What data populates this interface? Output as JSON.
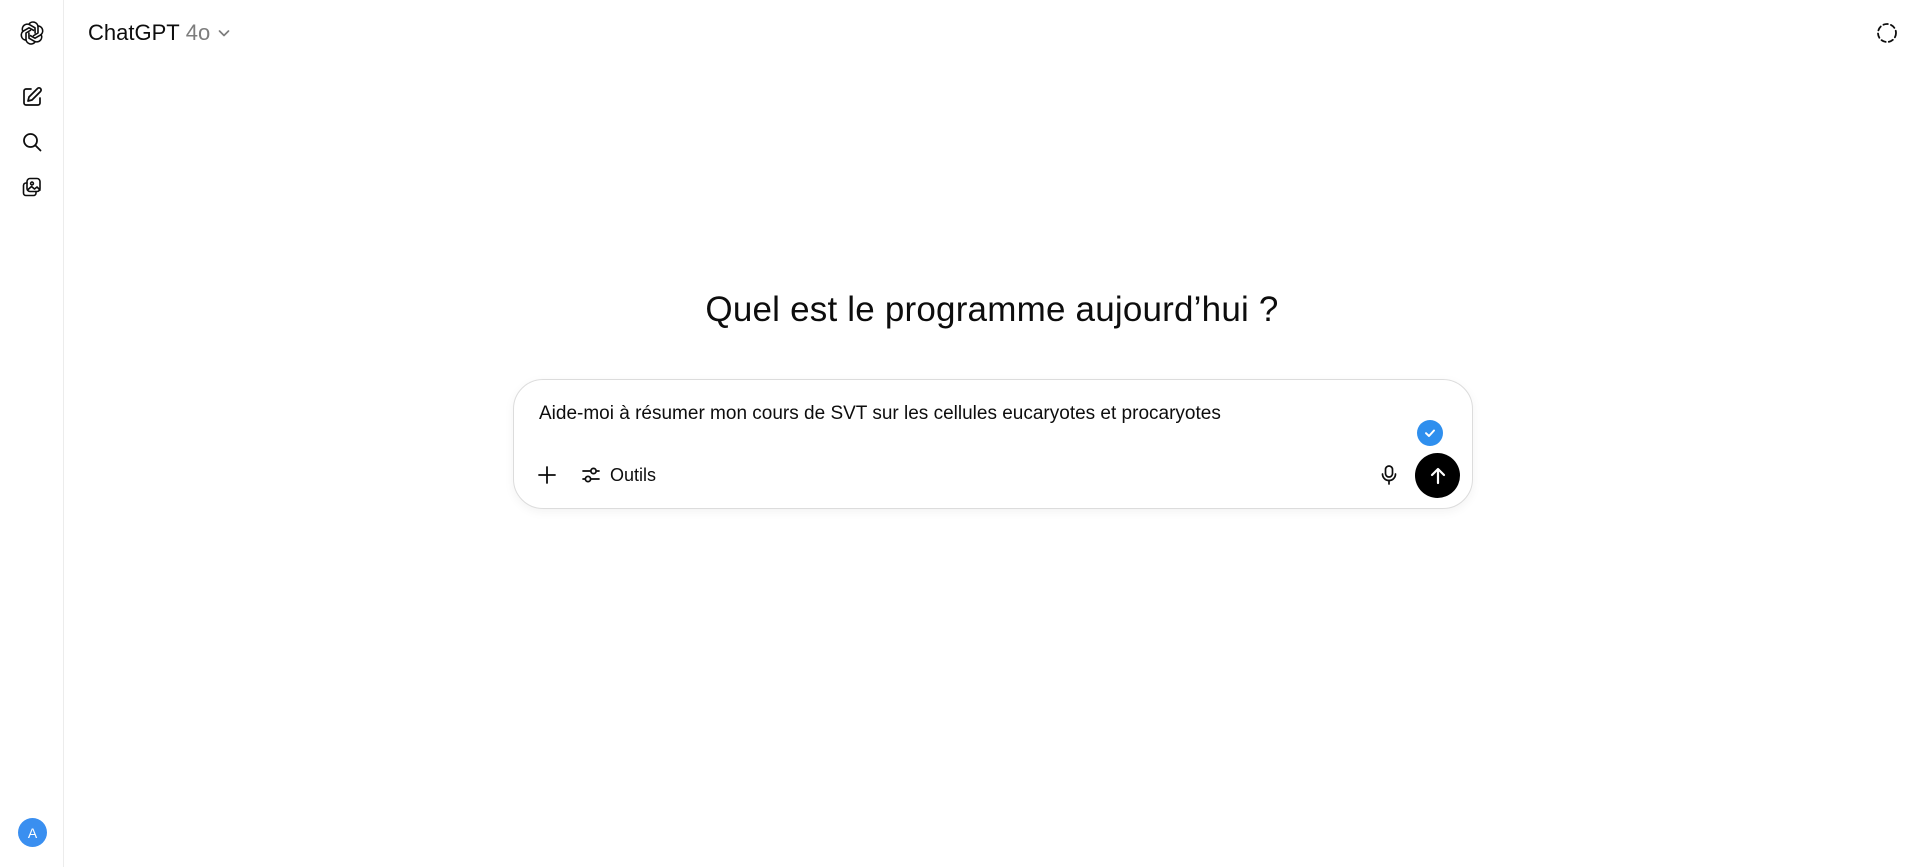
{
  "header": {
    "model_name": "ChatGPT",
    "model_version": "4o"
  },
  "sidebar": {
    "items": [
      {
        "name": "new-chat",
        "icon": "edit-icon"
      },
      {
        "name": "search",
        "icon": "search-icon"
      },
      {
        "name": "library",
        "icon": "images-icon"
      }
    ],
    "avatar_initial": "A",
    "avatar_color": "#3a8ff0"
  },
  "main": {
    "headline": "Quel est le programme aujourd’hui ?"
  },
  "composer": {
    "input_value": "Aide-moi à résumer mon cours de SVT sur les cellules eucaryotes et procaryotes",
    "tools_label": "Outils",
    "check_color": "#2f8fee",
    "send_color": "#000000"
  }
}
